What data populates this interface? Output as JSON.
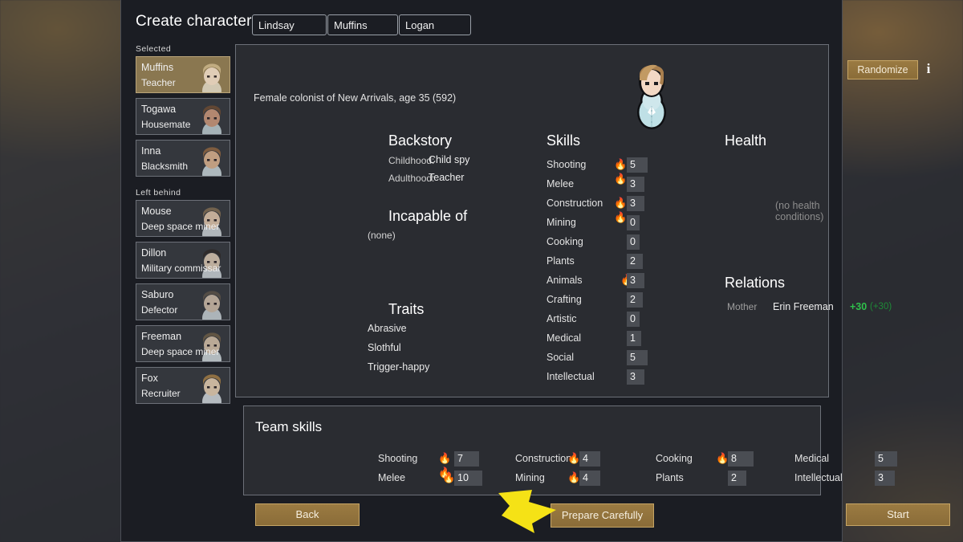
{
  "dialog": {
    "title": "Create characters"
  },
  "sidebar": {
    "selected_label": "Selected",
    "left_behind_label": "Left behind",
    "selected": [
      {
        "name": "Muffins",
        "role": "Teacher"
      },
      {
        "name": "Togawa",
        "role": "Housemate"
      },
      {
        "name": "Inna",
        "role": "Blacksmith"
      }
    ],
    "left_behind": [
      {
        "name": "Mouse",
        "role": "Deep space miner"
      },
      {
        "name": "Dillon",
        "role": "Military commissar"
      },
      {
        "name": "Saburo",
        "role": "Defector"
      },
      {
        "name": "Freeman",
        "role": "Deep space miner"
      },
      {
        "name": "Fox",
        "role": "Recruiter"
      }
    ]
  },
  "pawn": {
    "first_name": "Lindsay",
    "nick_name": "Muffins",
    "last_name": "Logan",
    "bio": "Female colonist of New Arrivals, age 35 (592)",
    "randomize_label": "Randomize",
    "info_icon_label": "i"
  },
  "backstory": {
    "heading": "Backstory",
    "childhood_label": "Childhood:",
    "childhood_value": "Child spy",
    "adulthood_label": "Adulthood:",
    "adulthood_value": "Teacher"
  },
  "incapable": {
    "heading": "Incapable of",
    "value": "(none)"
  },
  "traits": {
    "heading": "Traits",
    "items": [
      "Abrasive",
      "Slothful",
      "Trigger-happy"
    ]
  },
  "skills": {
    "heading": "Skills",
    "max": 20,
    "items": [
      {
        "name": "Shooting",
        "value": 5,
        "passion": 2
      },
      {
        "name": "Melee",
        "value": 3,
        "passion": 0
      },
      {
        "name": "Construction",
        "value": 3,
        "passion": 2
      },
      {
        "name": "Mining",
        "value": 0,
        "passion": 0
      },
      {
        "name": "Cooking",
        "value": 0,
        "passion": 0
      },
      {
        "name": "Plants",
        "value": 2,
        "passion": 0
      },
      {
        "name": "Animals",
        "value": 3,
        "passion": 1
      },
      {
        "name": "Crafting",
        "value": 2,
        "passion": 0
      },
      {
        "name": "Artistic",
        "value": 0,
        "passion": 0
      },
      {
        "name": "Medical",
        "value": 1,
        "passion": 0
      },
      {
        "name": "Social",
        "value": 5,
        "passion": 0
      },
      {
        "name": "Intellectual",
        "value": 3,
        "passion": 0
      }
    ]
  },
  "health": {
    "heading": "Health",
    "status": "(no health conditions)"
  },
  "relations": {
    "heading": "Relations",
    "items": [
      {
        "kind": "Mother",
        "name": "Erin Freeman",
        "opinion": "+30",
        "opinion_secondary": "(+30)",
        "color": "#2fbf4b"
      }
    ]
  },
  "team_skills": {
    "heading": "Team skills",
    "max": 20,
    "columns": [
      [
        {
          "name": "Shooting",
          "value": 7,
          "passion": 2
        },
        {
          "name": "Melee",
          "value": 10,
          "passion": 1
        }
      ],
      [
        {
          "name": "Construction",
          "value": 4,
          "passion": 1
        },
        {
          "name": "Mining",
          "value": 4,
          "passion": 1
        }
      ],
      [
        {
          "name": "Cooking",
          "value": 8,
          "passion": 1
        },
        {
          "name": "Plants",
          "value": 2,
          "passion": 0
        }
      ],
      [
        {
          "name": "Medical",
          "value": 5,
          "passion": 0
        },
        {
          "name": "Intellectual",
          "value": 3,
          "passion": 0
        }
      ]
    ]
  },
  "footer": {
    "back_label": "Back",
    "prepare_label": "Prepare Carefully",
    "start_label": "Start"
  },
  "colors": {
    "accent_button": "#8a6c38",
    "selected_row": "#8a7750",
    "positive": "#2fbf4b",
    "arrow": "#f5e216"
  }
}
